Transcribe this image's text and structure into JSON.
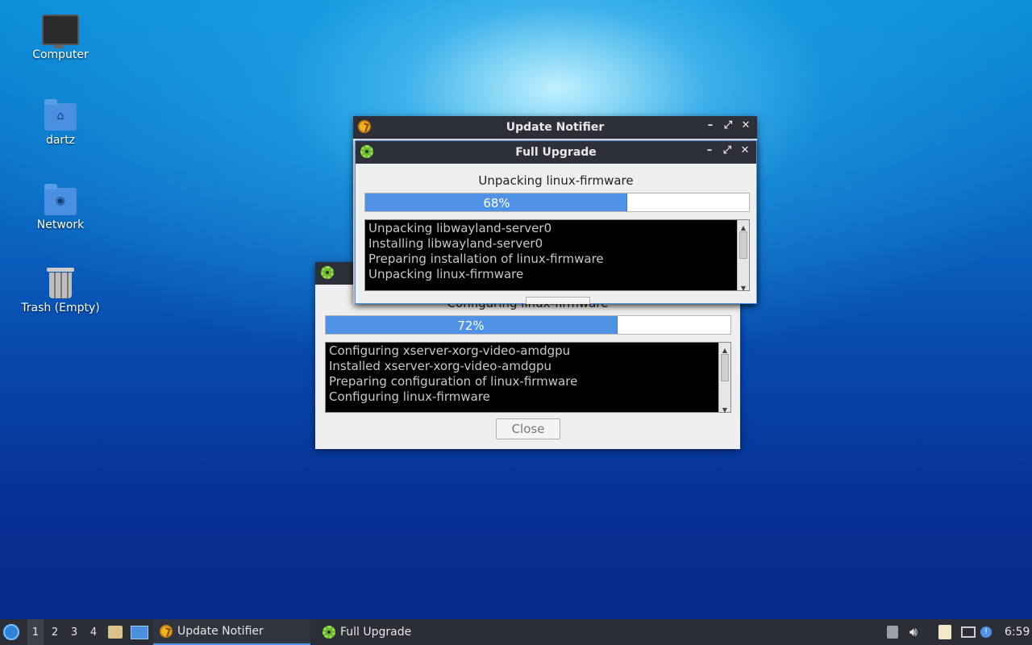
{
  "desktop": {
    "icons": [
      {
        "label": "Computer",
        "icon": "computer-icon"
      },
      {
        "label": "dartz",
        "icon": "home-folder-icon"
      },
      {
        "label": "Network",
        "icon": "network-folder-icon"
      },
      {
        "label": "Trash (Empty)",
        "icon": "trash-icon"
      }
    ]
  },
  "update_notifier": {
    "title": "Update Notifier",
    "icon": "update-notifier-icon"
  },
  "upgrade_front": {
    "title": "Full Upgrade",
    "status": "Unpacking linux-firmware",
    "progress_label": "68%",
    "progress_fraction": 0.68,
    "log": [
      "Unpacking libwayland-server0",
      "Installing libwayland-server0",
      "Preparing installation of linux-firmware",
      "Unpacking linux-firmware"
    ]
  },
  "upgrade_back": {
    "status": "Configuring linux-firmware",
    "progress_label": "72%",
    "progress_fraction": 0.72,
    "log": [
      "Configuring xserver-xorg-video-amdgpu",
      "Installed xserver-xorg-video-amdgpu",
      "Preparing configuration of linux-firmware",
      "Configuring linux-firmware"
    ],
    "close_label": "Close"
  },
  "window_controls": {
    "minimize": "–",
    "maximize": "⤢",
    "close": "✕"
  },
  "taskbar": {
    "workspaces": [
      "1",
      "2",
      "3",
      "4"
    ],
    "tasks": [
      {
        "label": "Update Notifier",
        "icon": "update-notifier-icon"
      },
      {
        "label": "Full Upgrade",
        "icon": "gear-icon"
      }
    ],
    "clock": "6:59"
  },
  "colors": {
    "progress": "#4f92e6",
    "titlebar": "#2d3038",
    "taskbar": "#2b2e36"
  }
}
